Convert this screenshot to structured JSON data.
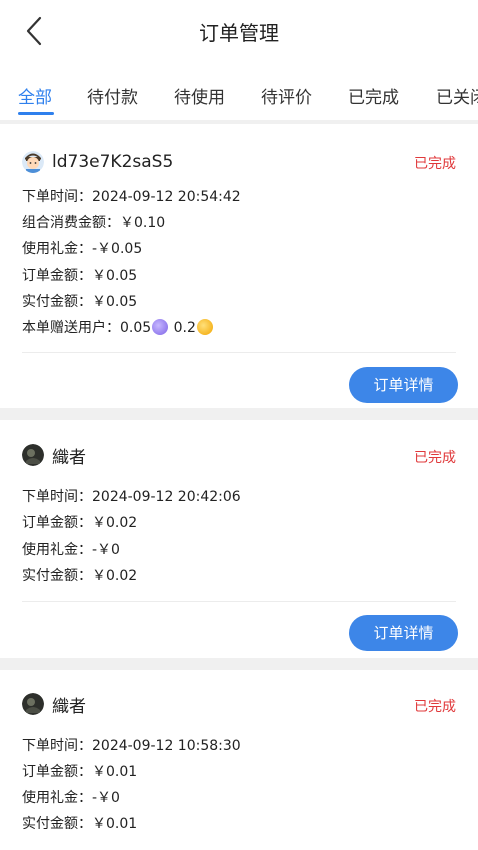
{
  "header": {
    "title": "订单管理",
    "back_icon": "chevron-left-icon"
  },
  "tabs": [
    {
      "label": "全部",
      "active": true
    },
    {
      "label": "待付款"
    },
    {
      "label": "待使用"
    },
    {
      "label": "待评价"
    },
    {
      "label": "已完成"
    },
    {
      "label": "已关闭"
    }
  ],
  "orders": [
    {
      "user": "ld73e7K2saS5",
      "avatar": "cartoon-face-avatar",
      "status": "已完成",
      "lines": {
        "time": "下单时间：2024-09-12 20:54:42",
        "combo": "组合消费金额：￥0.10",
        "gift": "使用礼金：-￥0.05",
        "amount": "订单金额：￥0.05",
        "paid": "实付金额：￥0.05",
        "bonus_prefix": "本单赠送用户：0.05",
        "bonus_mid": " 0.2"
      },
      "button": "订单详情"
    },
    {
      "user": "織者",
      "avatar": "dark-photo-avatar",
      "status": "已完成",
      "lines": {
        "time": "下单时间：2024-09-12 20:42:06",
        "amount": "订单金额：￥0.02",
        "gift": "使用礼金：-￥0",
        "paid": "实付金额：￥0.02"
      },
      "button": "订单详情"
    },
    {
      "user": "織者",
      "avatar": "dark-photo-avatar",
      "status": "已完成",
      "lines": {
        "time": "下单时间：2024-09-12 10:58:30",
        "amount": "订单金额：￥0.01",
        "gift": "使用礼金：-￥0",
        "paid": "实付金额：￥0.01"
      }
    }
  ],
  "colors": {
    "accent": "#2f80ed",
    "status": "#e0393b",
    "button": "#3d86e8"
  }
}
